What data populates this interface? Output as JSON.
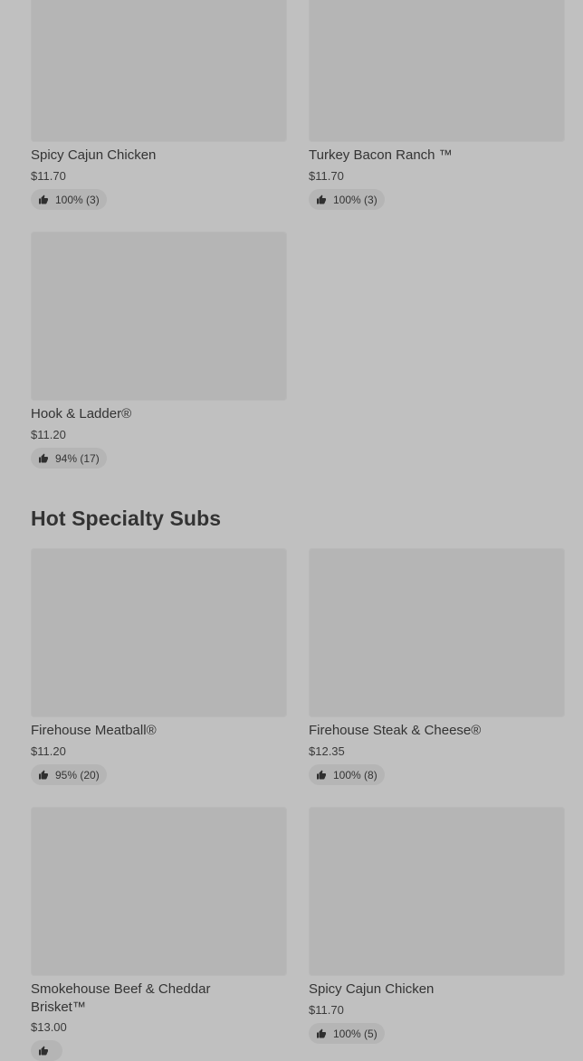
{
  "top_items": [
    {
      "name": "Spicy Cajun Chicken",
      "price": "$11.70",
      "rating": "100% (3)",
      "icon": "thumbs-up-icon"
    },
    {
      "name": "Turkey Bacon Ranch ™",
      "price": "$11.70",
      "rating": "100% (3)",
      "icon": "thumbs-up-icon"
    },
    {
      "name": "Hook & Ladder®",
      "price": "$11.20",
      "rating": "94% (17)",
      "icon": "thumbs-up-icon"
    }
  ],
  "hot_section": {
    "title": "Hot Specialty Subs",
    "items": [
      {
        "name": "Firehouse Meatball®",
        "price": "$11.20",
        "rating": "95% (20)",
        "icon": "thumbs-up-icon"
      },
      {
        "name": "Firehouse Steak & Cheese®",
        "price": "$12.35",
        "rating": "100% (8)",
        "icon": "thumbs-up-icon"
      },
      {
        "name": "Smokehouse Beef & Cheddar Brisket™",
        "price": "$13.00",
        "rating": "",
        "icon": "thumbs-up-icon"
      },
      {
        "name": "Spicy Cajun Chicken",
        "price": "$11.70",
        "rating": "100% (5)",
        "icon": "thumbs-up-icon"
      }
    ]
  }
}
